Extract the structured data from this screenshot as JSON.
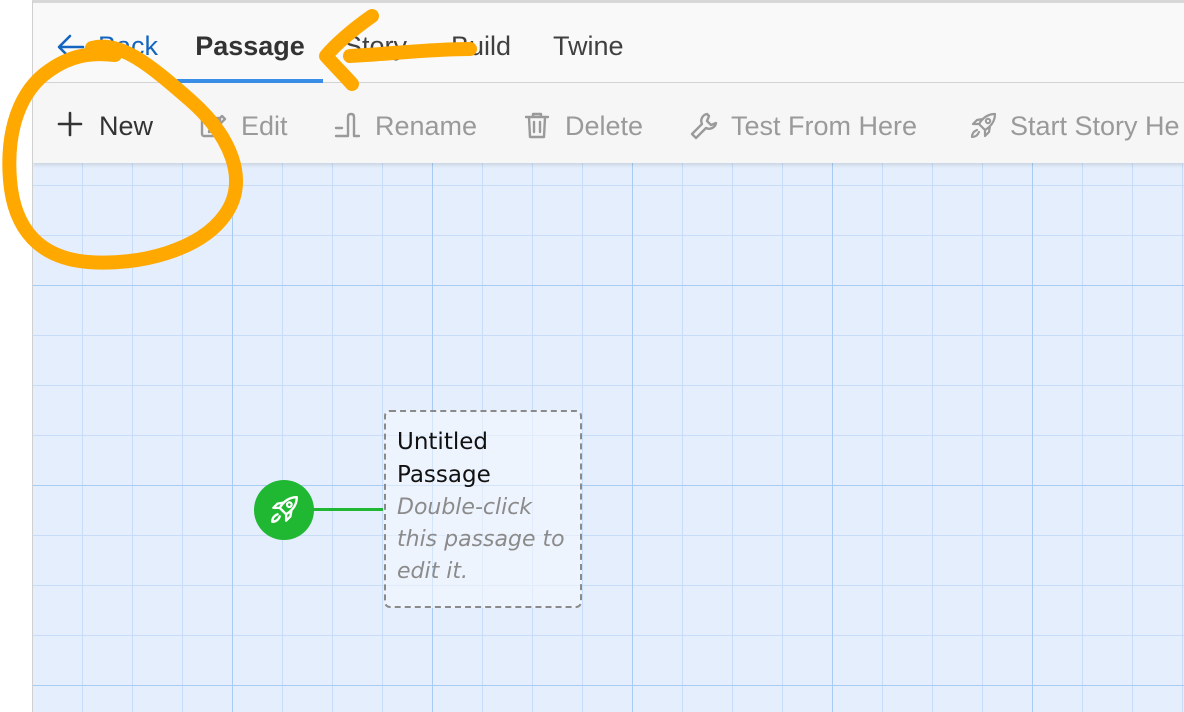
{
  "tabs": [
    {
      "label": "Back",
      "icon": "arrow-left-icon"
    },
    {
      "label": "Passage",
      "active": true
    },
    {
      "label": "Story"
    },
    {
      "label": "Build"
    },
    {
      "label": "Twine"
    }
  ],
  "toolbar": {
    "new_label": "New",
    "edit_label": "Edit",
    "rename_label": "Rename",
    "delete_label": "Delete",
    "test_label": "Test From Here",
    "start_label": "Start Story He"
  },
  "passage": {
    "title": "Untitled Passage",
    "excerpt": "Double-click this passage to edit it."
  },
  "colors": {
    "accent": "#3b8ee8",
    "link": "#1565c0",
    "start_marker": "#20b832",
    "annotation": "#ffa800",
    "map_background": "#e4eefc"
  }
}
